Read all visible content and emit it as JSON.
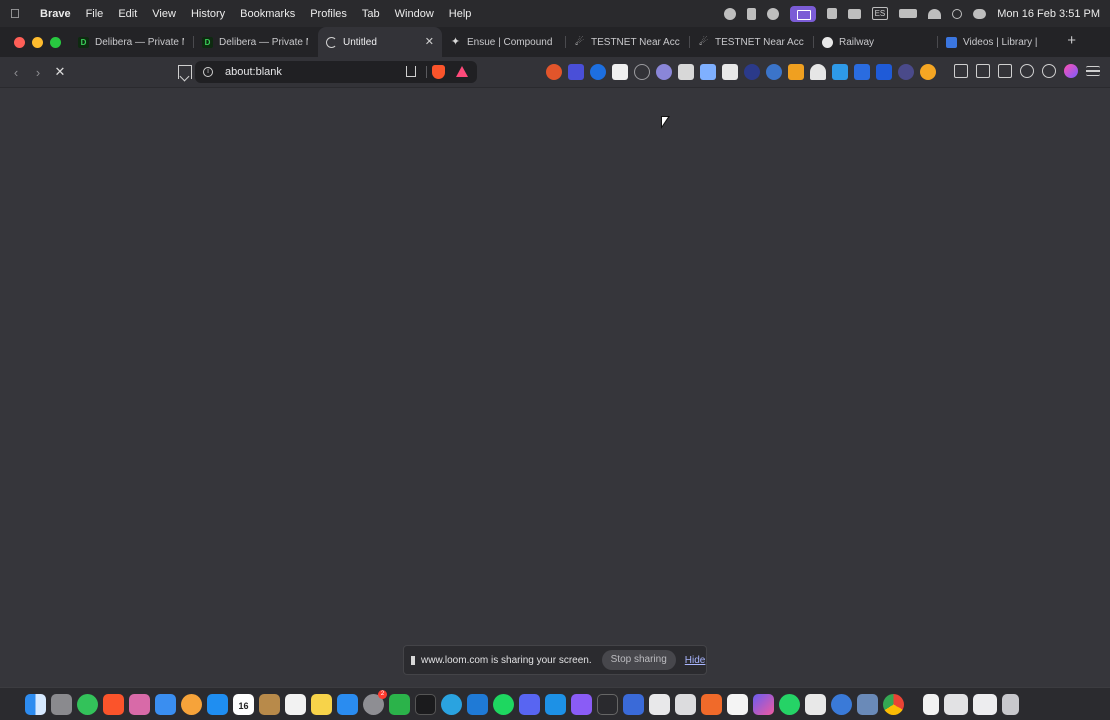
{
  "menubar": {
    "app_name": "Brave",
    "items": [
      "File",
      "Edit",
      "View",
      "History",
      "Bookmarks",
      "Profiles",
      "Tab",
      "Window",
      "Help"
    ],
    "input_source": "ES",
    "clock": "Mon 16 Feb  3:51 PM"
  },
  "tabs": [
    {
      "label": "Delibera — Private M",
      "icon": "delibera-icon"
    },
    {
      "label": "Delibera — Private M",
      "icon": "delibera-icon"
    },
    {
      "label": "Untitled",
      "icon": "loading-spinner-icon",
      "active": true
    },
    {
      "label": "Ensue | Compound In",
      "icon": "ensue-icon"
    },
    {
      "label": "TESTNET Near Accou",
      "icon": "near-icon"
    },
    {
      "label": "TESTNET Near Accou",
      "icon": "near-icon"
    },
    {
      "label": "Railway",
      "icon": "railway-icon"
    },
    {
      "label": "Videos | Library |",
      "icon": "video-icon"
    }
  ],
  "favicon_letters": {
    "delibera": "D"
  },
  "toolbar": {
    "url": "about:blank"
  },
  "share_bar": {
    "message": "www.loom.com is sharing your screen.",
    "stop_label": "Stop sharing",
    "hide_label": "Hide"
  },
  "dock": {
    "calendar_day": "16",
    "mail_badge": "2"
  },
  "colors": {
    "accent": "#7b5cd6",
    "brave": "#fb542b",
    "content_bg": "#36363b"
  }
}
